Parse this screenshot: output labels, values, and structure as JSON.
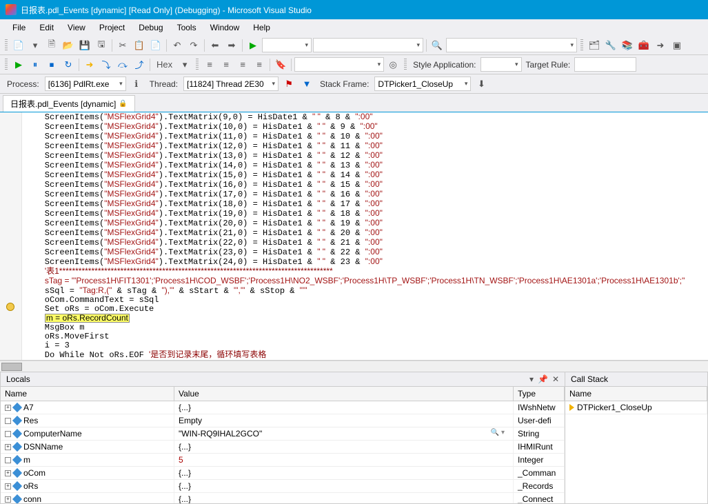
{
  "title": "日报表.pdl_Events [dynamic] [Read Only] (Debugging) - Microsoft Visual Studio",
  "menu": [
    "File",
    "Edit",
    "View",
    "Project",
    "Debug",
    "Tools",
    "Window",
    "Help"
  ],
  "toolbar2": {
    "hex_label": "Hex",
    "style_app_label": "Style Application:",
    "target_rule_label": "Target Rule:"
  },
  "proc": {
    "process_label": "Process:",
    "process_value": "[6136] PdlRt.exe",
    "thread_label": "Thread:",
    "thread_value": "[11824] Thread 2E30",
    "stack_label": "Stack Frame:",
    "stack_value": "DTPicker1_CloseUp"
  },
  "tab": {
    "label": "日报表.pdl_Events [dynamic]"
  },
  "code_rows": [
    {
      "a": 9,
      "b": 8
    },
    {
      "a": 10,
      "b": 9
    },
    {
      "a": 11,
      "b": 10
    },
    {
      "a": 12,
      "b": 11
    },
    {
      "a": 13,
      "b": 12
    },
    {
      "a": 14,
      "b": 13
    },
    {
      "a": 15,
      "b": 14
    },
    {
      "a": 16,
      "b": 15
    },
    {
      "a": 17,
      "b": 16
    },
    {
      "a": 18,
      "b": 17
    },
    {
      "a": 19,
      "b": 18
    },
    {
      "a": 20,
      "b": 19
    },
    {
      "a": 21,
      "b": 20
    },
    {
      "a": 22,
      "b": 21
    },
    {
      "a": 23,
      "b": 22
    },
    {
      "a": 24,
      "b": 23
    }
  ],
  "code_tail": {
    "comment1": "'表1*************************************************************************************",
    "stag_line": "sTag = \"'Process1H\\FIT1301';'Process1H\\COD_WSBF';'Process1H\\NO2_WSBF';'Process1H\\TP_WSBF';'Process1H\\TN_WSBF';'Process1H\\AE1301a';'Process1H\\AE1301b';\"",
    "ssql_line": "sSql = \"Tag:R,(\" & sTag & \"),'\" & sStart & \"','\" & sStop & \"'\"",
    "l3": "oCom.CommandText = sSql",
    "l4": "Set oRs = oCom.Execute",
    "l5": "m = oRs.RecordCount",
    "l6": "MsgBox m",
    "l7": "oRs.MoveFirst",
    "l8": "i = 3",
    "l9_a": "Do While Not oRs.EOF ",
    "l9_b": "'是否到记录末尾，循环填写表格"
  },
  "locals": {
    "title": "Locals",
    "headers": {
      "name": "Name",
      "value": "Value",
      "type": "Type"
    },
    "rows": [
      {
        "exp": true,
        "name": "A7",
        "value": "{...}",
        "type": "IWshNetw"
      },
      {
        "exp": false,
        "name": "Res",
        "value": "Empty",
        "type": "User-defi"
      },
      {
        "exp": false,
        "name": "ComputerName",
        "value": "\"WIN-RQ9IHAL2GCO\"",
        "type": "String",
        "mag": true
      },
      {
        "exp": true,
        "name": "DSNName",
        "value": "{...}",
        "type": "IHMIRunt"
      },
      {
        "exp": false,
        "name": "m",
        "value": "5",
        "type": "Integer",
        "red": true
      },
      {
        "exp": true,
        "name": "oCom",
        "value": "{...}",
        "type": "_Comman"
      },
      {
        "exp": true,
        "name": "oRs",
        "value": "{...}",
        "type": "_Records"
      },
      {
        "exp": true,
        "name": "conn",
        "value": "{...}",
        "type": "_Connect"
      }
    ]
  },
  "callstack": {
    "title": "Call Stack",
    "headers": {
      "name": "Name"
    },
    "rows": [
      {
        "name": "DTPicker1_CloseUp"
      }
    ]
  }
}
